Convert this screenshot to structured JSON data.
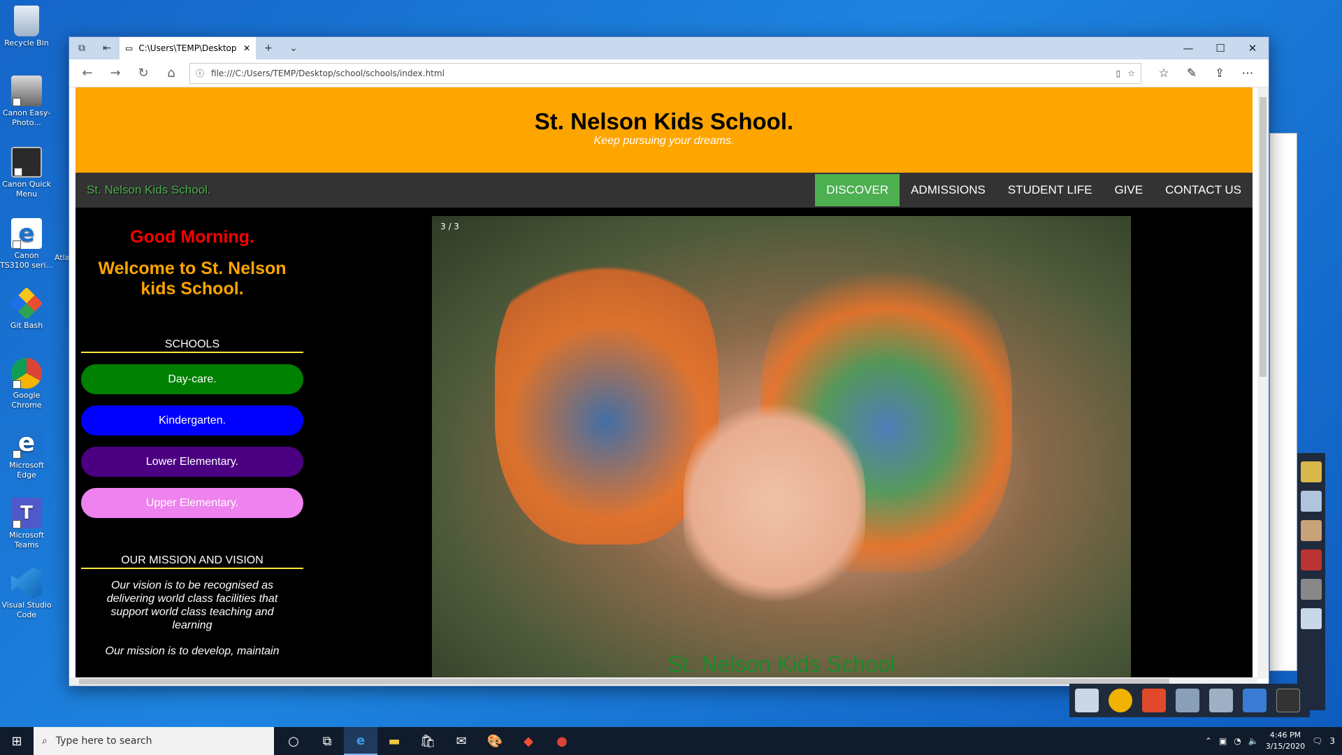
{
  "desktop": {
    "icons": [
      {
        "label": "Recycle Bin"
      },
      {
        "label": "Canon Easy-Photo..."
      },
      {
        "label": "Canon Quick Menu"
      },
      {
        "label": "Canon TS3100 seri..."
      },
      {
        "label": "Git Bash"
      },
      {
        "label": "Google Chrome"
      },
      {
        "label": "Microsoft Edge"
      },
      {
        "label": "Microsoft Teams"
      },
      {
        "label": "Visual Studio Code"
      }
    ],
    "partial_label": "Atla"
  },
  "browser": {
    "tab_title": "C:\\Users\\TEMP\\Desktop",
    "url": "file:///C:/Users/TEMP/Desktop/school/schools/index.html"
  },
  "site": {
    "title": "St. Nelson Kids School.",
    "tagline": "Keep pursuing your dreams.",
    "brand": "St. Nelson Kids School.",
    "menu": [
      {
        "label": "DISCOVER",
        "active": true
      },
      {
        "label": "ADMISSIONS"
      },
      {
        "label": "STUDENT LIFE"
      },
      {
        "label": "GIVE"
      },
      {
        "label": "CONTACT US"
      }
    ],
    "greeting": "Good Morning.",
    "welcome": "Welcome to St. Nelson kids School.",
    "schools_heading": "SCHOOLS",
    "schools": [
      {
        "label": "Day-care.",
        "color": "#008000"
      },
      {
        "label": "Kindergarten.",
        "color": "#0000ff"
      },
      {
        "label": "Lower Elementary.",
        "color": "#4b0082"
      },
      {
        "label": "Upper Elementary.",
        "color": "#ee82ee"
      }
    ],
    "mission_heading": "OUR MISSION AND VISION",
    "vision_text": "Our vision is to be recognised as delivering world class facilities that support world class teaching and learning",
    "mission_text": "Our mission is to develop, maintain",
    "slide_number": "3 / 3",
    "slide_caption": "St. Nelson Kids School"
  },
  "taskbar": {
    "search_placeholder": "Type here to search",
    "time": "4:46 PM",
    "date": "3/15/2020",
    "notification_count": "3"
  }
}
